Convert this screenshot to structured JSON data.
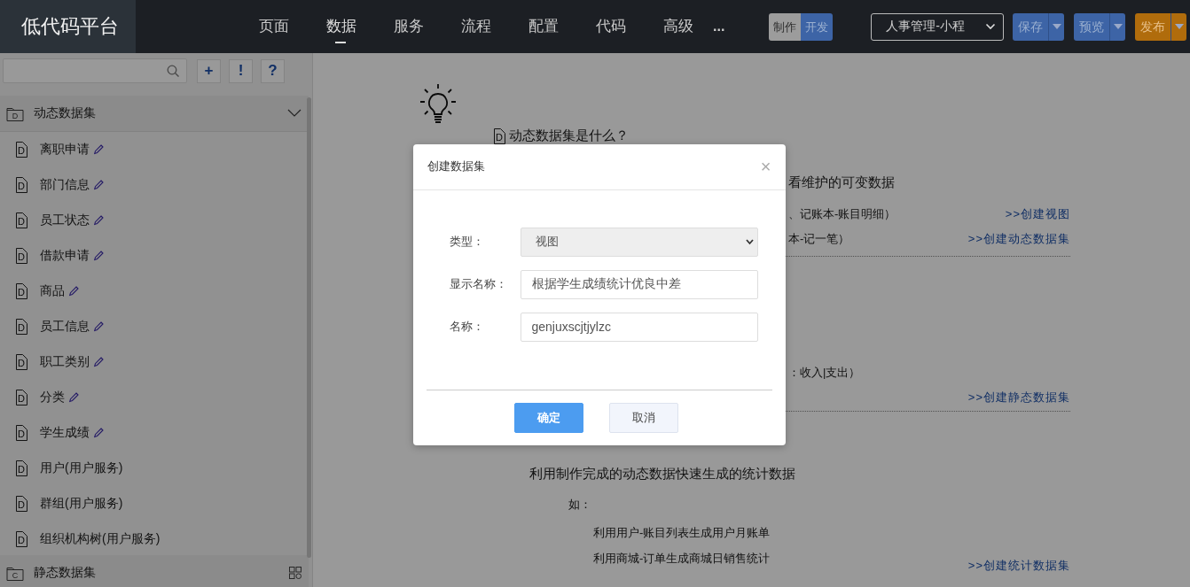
{
  "header": {
    "logo": "低代码平台",
    "nav": [
      {
        "label": "页面",
        "selected": false
      },
      {
        "label": "数据",
        "selected": true
      },
      {
        "label": "服务",
        "selected": false
      },
      {
        "label": "流程",
        "selected": false
      },
      {
        "label": "配置",
        "selected": false
      },
      {
        "label": "代码",
        "selected": false
      },
      {
        "label": "高级",
        "selected": false
      }
    ],
    "more": "...",
    "mode_toggle": [
      {
        "label": "制作",
        "selected": false
      },
      {
        "label": "开发",
        "selected": true
      }
    ],
    "app_select": "人事管理-小程",
    "buttons": [
      {
        "label": "保存",
        "kind": "primary"
      },
      {
        "label": "预览",
        "kind": "primary"
      },
      {
        "label": "发布",
        "kind": "warning"
      }
    ]
  },
  "sidebar": {
    "tools": [
      "+",
      "!",
      "?"
    ],
    "groups": [
      {
        "title": "动态数据集",
        "badge": "D",
        "expanded": true,
        "items": [
          {
            "badge": "D",
            "label": "离职申请",
            "editable": true
          },
          {
            "badge": "D",
            "label": "部门信息",
            "editable": true
          },
          {
            "badge": "D",
            "label": "员工状态",
            "editable": true
          },
          {
            "badge": "D",
            "label": "借款申请",
            "editable": true
          },
          {
            "badge": "D",
            "label": "商品",
            "editable": true
          },
          {
            "badge": "D",
            "label": "员工信息",
            "editable": true
          },
          {
            "badge": "D",
            "label": "职工类别",
            "editable": true
          },
          {
            "badge": "D",
            "label": "分类",
            "editable": true
          },
          {
            "badge": "D",
            "label": "学生成绩",
            "editable": true
          },
          {
            "badge": "D",
            "label": "用户(用户服务)",
            "editable": false
          },
          {
            "badge": "D",
            "label": "群组(用户服务)",
            "editable": false
          },
          {
            "badge": "D",
            "label": "组织机构树(用户服务)",
            "editable": false
          }
        ]
      },
      {
        "title": "静态数据集",
        "badge": "C",
        "expanded": false
      }
    ]
  },
  "guide": {
    "badge": "D",
    "title": "动态数据集是什么？",
    "sections": [
      {
        "lines": [
          {
            "kind": "fragment",
            "text": "看维护的可变数据"
          },
          {
            "kind": "fragment-small",
            "text": "、记账本-账目明细）",
            "link": ">>创建视图"
          },
          {
            "kind": "fragment-small",
            "text": "本-记一笔）",
            "link": ">>创建动态数据集"
          }
        ]
      },
      {
        "lines": [
          {
            "kind": "fragment-small",
            "text": "：收入|支出）"
          },
          {
            "kind": "link-only",
            "link": ">>创建静态数据集"
          }
        ]
      },
      {
        "lines": [
          {
            "kind": "desc",
            "text": "利用制作完成的动态数据快速生成的统计数据"
          },
          {
            "kind": "lead",
            "text": "如："
          },
          {
            "kind": "item",
            "text": "利用用户-账目列表生成用户月账单"
          },
          {
            "kind": "item",
            "text": "利用商城-订单生成商城日销售统计",
            "link": ">>创建统计数据集"
          }
        ]
      }
    ]
  },
  "dialog": {
    "title": "创建数据集",
    "close": "×",
    "fields": [
      {
        "kind": "select",
        "label": "类型：",
        "value": "视图",
        "disabled": true
      },
      {
        "kind": "text",
        "label": "显示名称：",
        "value": "根据学生成绩统计优良中差"
      },
      {
        "kind": "text",
        "label": "名称：",
        "value": "genjuxscjtjylzc"
      }
    ],
    "buttons": [
      {
        "label": "确定",
        "primary": true
      },
      {
        "label": "取消",
        "primary": false
      }
    ]
  }
}
